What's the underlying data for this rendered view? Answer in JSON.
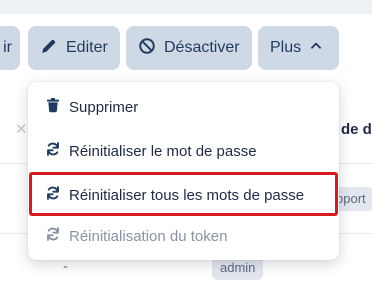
{
  "toolbar": {
    "prev_label": "ir",
    "edit_label": "Editer",
    "deactivate_label": "Désactiver",
    "more_label": "Plus"
  },
  "table": {
    "partial_header": "de d",
    "dash": "-",
    "tags": [
      "pport",
      "admin"
    ]
  },
  "menu": {
    "items": [
      {
        "label": "Supprimer",
        "icon": "trash-icon"
      },
      {
        "label": "Réinitialiser le mot de passe",
        "icon": "refresh-icon"
      },
      {
        "label": "Réinitialiser tous les mots de passe",
        "icon": "refresh-icon",
        "highlighted": true
      },
      {
        "label": "Réinitialisation du token",
        "icon": "refresh-icon",
        "disabled": true
      }
    ]
  },
  "colors": {
    "button_bg": "#cfd9e6",
    "button_text": "#1f3a5f",
    "highlight_border": "#d71920",
    "disabled_text": "#8a93a3"
  }
}
